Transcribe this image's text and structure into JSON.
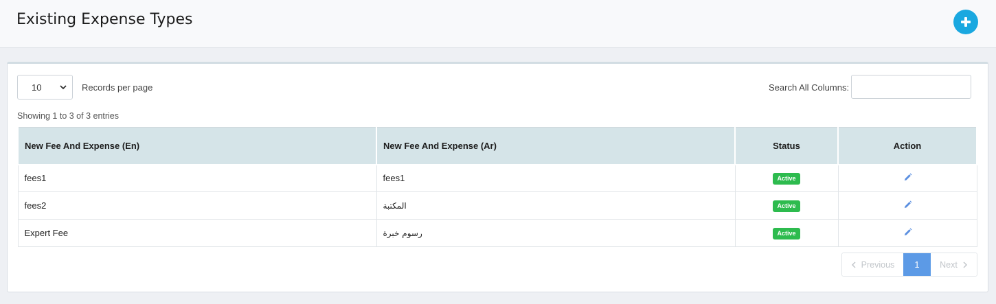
{
  "header": {
    "title": "Existing Expense Types",
    "add_icon": "plus-circle-icon",
    "accent_color": "#1aa8e0"
  },
  "controls": {
    "page_length_value": "10",
    "records_per_page_label": "Records per page",
    "search_label": "Search All Columns:",
    "search_value": "",
    "info": "Showing 1 to 3 of 3 entries"
  },
  "table": {
    "columns": [
      "New Fee And Expense (En)",
      "New Fee And Expense (Ar)",
      "Status",
      "Action"
    ],
    "rows": [
      {
        "en": "fees1",
        "ar": "fees1",
        "status": "Active"
      },
      {
        "en": "fees2",
        "ar": "المكتبة",
        "status": "Active"
      },
      {
        "en": "Expert Fee",
        "ar": "رسوم خبرة",
        "status": "Active"
      }
    ],
    "action_icon": "pencil-icon",
    "status_color": "#2dbb4e"
  },
  "pagination": {
    "previous_label": "Previous",
    "current_page": "1",
    "next_label": "Next"
  }
}
